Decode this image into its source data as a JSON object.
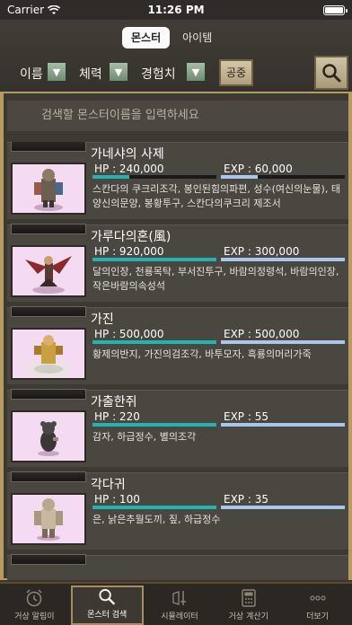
{
  "status_bar": {
    "carrier": "Carrier",
    "time": "11:26 PM"
  },
  "segmented": {
    "monster": "몬스터",
    "item": "아이템"
  },
  "sort": {
    "name_label": "이름",
    "hp_label": "체력",
    "exp_label": "경험치",
    "gongjung_label": "공중"
  },
  "search": {
    "placeholder": "검색할 몬스터이름을 입력하세요"
  },
  "monsters": [
    {
      "name": "가네샤의 사제",
      "hp": "HP : 240,000",
      "exp": "EXP : 60,000",
      "hp_fill": 0.3,
      "exp_fill": 0.3,
      "items": "스칸다의 쿠크리조각, 봉인된힘의파편, 성수(여신의눈물), 태양신의문양, 봉황투구, 스칸다의쿠크리 제조서"
    },
    {
      "name": "가루다의혼(風)",
      "hp": "HP : 920,000",
      "exp": "EXP : 300,000",
      "hp_fill": 1.0,
      "exp_fill": 1.0,
      "items": "달의인장, 천룡목탁, 부서진투구, 바람의정령석, 바람의인장, 작은바람의속성석"
    },
    {
      "name": "가진",
      "hp": "HP : 500,000",
      "exp": "EXP : 500,000",
      "hp_fill": 1.0,
      "exp_fill": 1.0,
      "items": "황제의반지, 가진의검조각, 바투모자, 흑룡의머리가죽"
    },
    {
      "name": "가출한쥐",
      "hp": "HP : 220",
      "exp": "EXP : 55",
      "hp_fill": 1.0,
      "exp_fill": 1.0,
      "items": "감자, 하급정수, 별의조각"
    },
    {
      "name": "각다귀",
      "hp": "HP : 100",
      "exp": "EXP : 35",
      "hp_fill": 1.0,
      "exp_fill": 1.0,
      "items": "은, 낡은추월도끼, 짚, 하급정수"
    }
  ],
  "tabs": [
    {
      "label": "거상 알림이",
      "icon": "alarm-clock-icon"
    },
    {
      "label": "몬스터 검색",
      "icon": "search-icon"
    },
    {
      "label": "시뮬레이터",
      "icon": "armor-sword-icon"
    },
    {
      "label": "거상 계산기",
      "icon": "calculator-icon"
    },
    {
      "label": "더보기",
      "icon": "more-dots-icon"
    }
  ],
  "colors": {
    "hp_bar": "#22b3b3",
    "exp_bar": "#a9c6ec",
    "thumb_bg": "#f4dbf1",
    "frame_gold": "#b69a60"
  }
}
